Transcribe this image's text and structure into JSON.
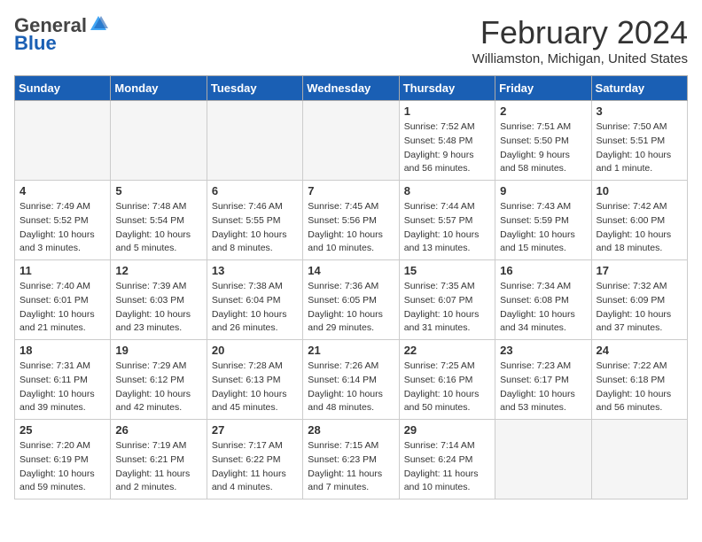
{
  "header": {
    "logo_general": "General",
    "logo_blue": "Blue",
    "month_title": "February 2024",
    "location": "Williamston, Michigan, United States"
  },
  "days_of_week": [
    "Sunday",
    "Monday",
    "Tuesday",
    "Wednesday",
    "Thursday",
    "Friday",
    "Saturday"
  ],
  "weeks": [
    {
      "row_class": "row-odd",
      "days": [
        {
          "num": "",
          "info": "",
          "empty": true
        },
        {
          "num": "",
          "info": "",
          "empty": true
        },
        {
          "num": "",
          "info": "",
          "empty": true
        },
        {
          "num": "",
          "info": "",
          "empty": true
        },
        {
          "num": "1",
          "info": "Sunrise: 7:52 AM\nSunset: 5:48 PM\nDaylight: 9 hours\nand 56 minutes.",
          "empty": false
        },
        {
          "num": "2",
          "info": "Sunrise: 7:51 AM\nSunset: 5:50 PM\nDaylight: 9 hours\nand 58 minutes.",
          "empty": false
        },
        {
          "num": "3",
          "info": "Sunrise: 7:50 AM\nSunset: 5:51 PM\nDaylight: 10 hours\nand 1 minute.",
          "empty": false
        }
      ]
    },
    {
      "row_class": "row-even",
      "days": [
        {
          "num": "4",
          "info": "Sunrise: 7:49 AM\nSunset: 5:52 PM\nDaylight: 10 hours\nand 3 minutes.",
          "empty": false
        },
        {
          "num": "5",
          "info": "Sunrise: 7:48 AM\nSunset: 5:54 PM\nDaylight: 10 hours\nand 5 minutes.",
          "empty": false
        },
        {
          "num": "6",
          "info": "Sunrise: 7:46 AM\nSunset: 5:55 PM\nDaylight: 10 hours\nand 8 minutes.",
          "empty": false
        },
        {
          "num": "7",
          "info": "Sunrise: 7:45 AM\nSunset: 5:56 PM\nDaylight: 10 hours\nand 10 minutes.",
          "empty": false
        },
        {
          "num": "8",
          "info": "Sunrise: 7:44 AM\nSunset: 5:57 PM\nDaylight: 10 hours\nand 13 minutes.",
          "empty": false
        },
        {
          "num": "9",
          "info": "Sunrise: 7:43 AM\nSunset: 5:59 PM\nDaylight: 10 hours\nand 15 minutes.",
          "empty": false
        },
        {
          "num": "10",
          "info": "Sunrise: 7:42 AM\nSunset: 6:00 PM\nDaylight: 10 hours\nand 18 minutes.",
          "empty": false
        }
      ]
    },
    {
      "row_class": "row-odd",
      "days": [
        {
          "num": "11",
          "info": "Sunrise: 7:40 AM\nSunset: 6:01 PM\nDaylight: 10 hours\nand 21 minutes.",
          "empty": false
        },
        {
          "num": "12",
          "info": "Sunrise: 7:39 AM\nSunset: 6:03 PM\nDaylight: 10 hours\nand 23 minutes.",
          "empty": false
        },
        {
          "num": "13",
          "info": "Sunrise: 7:38 AM\nSunset: 6:04 PM\nDaylight: 10 hours\nand 26 minutes.",
          "empty": false
        },
        {
          "num": "14",
          "info": "Sunrise: 7:36 AM\nSunset: 6:05 PM\nDaylight: 10 hours\nand 29 minutes.",
          "empty": false
        },
        {
          "num": "15",
          "info": "Sunrise: 7:35 AM\nSunset: 6:07 PM\nDaylight: 10 hours\nand 31 minutes.",
          "empty": false
        },
        {
          "num": "16",
          "info": "Sunrise: 7:34 AM\nSunset: 6:08 PM\nDaylight: 10 hours\nand 34 minutes.",
          "empty": false
        },
        {
          "num": "17",
          "info": "Sunrise: 7:32 AM\nSunset: 6:09 PM\nDaylight: 10 hours\nand 37 minutes.",
          "empty": false
        }
      ]
    },
    {
      "row_class": "row-even",
      "days": [
        {
          "num": "18",
          "info": "Sunrise: 7:31 AM\nSunset: 6:11 PM\nDaylight: 10 hours\nand 39 minutes.",
          "empty": false
        },
        {
          "num": "19",
          "info": "Sunrise: 7:29 AM\nSunset: 6:12 PM\nDaylight: 10 hours\nand 42 minutes.",
          "empty": false
        },
        {
          "num": "20",
          "info": "Sunrise: 7:28 AM\nSunset: 6:13 PM\nDaylight: 10 hours\nand 45 minutes.",
          "empty": false
        },
        {
          "num": "21",
          "info": "Sunrise: 7:26 AM\nSunset: 6:14 PM\nDaylight: 10 hours\nand 48 minutes.",
          "empty": false
        },
        {
          "num": "22",
          "info": "Sunrise: 7:25 AM\nSunset: 6:16 PM\nDaylight: 10 hours\nand 50 minutes.",
          "empty": false
        },
        {
          "num": "23",
          "info": "Sunrise: 7:23 AM\nSunset: 6:17 PM\nDaylight: 10 hours\nand 53 minutes.",
          "empty": false
        },
        {
          "num": "24",
          "info": "Sunrise: 7:22 AM\nSunset: 6:18 PM\nDaylight: 10 hours\nand 56 minutes.",
          "empty": false
        }
      ]
    },
    {
      "row_class": "row-odd",
      "days": [
        {
          "num": "25",
          "info": "Sunrise: 7:20 AM\nSunset: 6:19 PM\nDaylight: 10 hours\nand 59 minutes.",
          "empty": false
        },
        {
          "num": "26",
          "info": "Sunrise: 7:19 AM\nSunset: 6:21 PM\nDaylight: 11 hours\nand 2 minutes.",
          "empty": false
        },
        {
          "num": "27",
          "info": "Sunrise: 7:17 AM\nSunset: 6:22 PM\nDaylight: 11 hours\nand 4 minutes.",
          "empty": false
        },
        {
          "num": "28",
          "info": "Sunrise: 7:15 AM\nSunset: 6:23 PM\nDaylight: 11 hours\nand 7 minutes.",
          "empty": false
        },
        {
          "num": "29",
          "info": "Sunrise: 7:14 AM\nSunset: 6:24 PM\nDaylight: 11 hours\nand 10 minutes.",
          "empty": false
        },
        {
          "num": "",
          "info": "",
          "empty": true
        },
        {
          "num": "",
          "info": "",
          "empty": true
        }
      ]
    }
  ]
}
